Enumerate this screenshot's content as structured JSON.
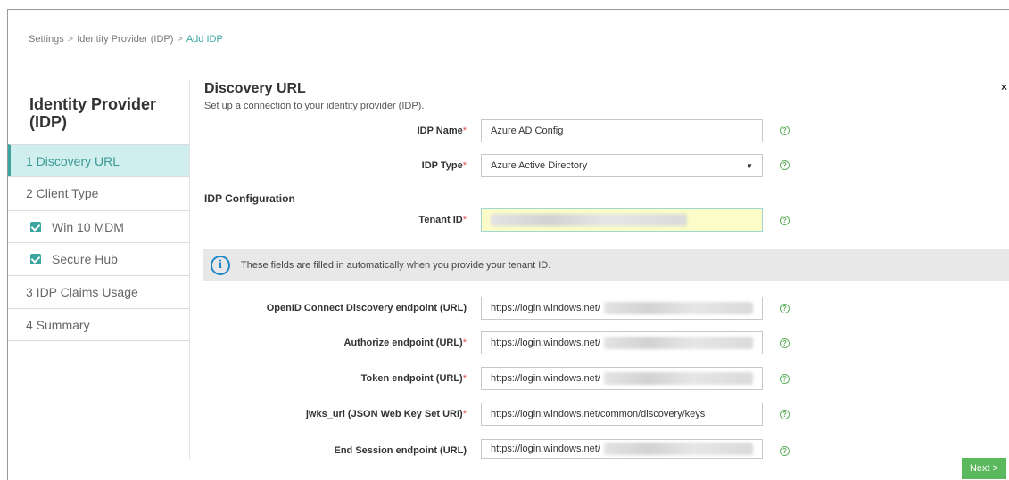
{
  "breadcrumb": {
    "item1": "Settings",
    "item2": "Identity Provider (IDP)",
    "item3": "Add IDP",
    "sep": ">"
  },
  "close": {
    "glyph": "×"
  },
  "sidebar": {
    "title": "Identity Provider (IDP)",
    "items": [
      {
        "label": "1  Discovery URL"
      },
      {
        "label": "2  Client Type"
      },
      {
        "label": "Win 10 MDM"
      },
      {
        "label": "Secure Hub"
      },
      {
        "label": "3  IDP Claims Usage"
      },
      {
        "label": "4  Summary"
      }
    ]
  },
  "main": {
    "title": "Discovery URL",
    "subtitle": "Set up a connection to your identity provider (IDP).",
    "idp_name": {
      "label": "IDP Name",
      "value": "Azure AD Config"
    },
    "idp_type": {
      "label": "IDP Type",
      "value": "Azure Active Directory"
    },
    "config_heading": "IDP Configuration",
    "tenant_id": {
      "label": "Tenant ID"
    },
    "info_text": "These fields are filled in automatically when you provide your tenant ID.",
    "openid": {
      "label": "OpenID Connect Discovery endpoint (URL)",
      "value": "https://login.windows.net/"
    },
    "authorize": {
      "label": "Authorize endpoint (URL)",
      "value": "https://login.windows.net/"
    },
    "token": {
      "label": "Token endpoint (URL)",
      "value": "https://login.windows.net/"
    },
    "jwks": {
      "label": "jwks_uri (JSON Web Key Set URI)",
      "value": "https://login.windows.net/common/discovery/keys"
    },
    "end_session": {
      "label": "End Session endpoint (URL)",
      "value": "https://login.windows.net/"
    },
    "required_mark": "*",
    "help_glyph": "?"
  },
  "footer": {
    "next_label": "Next >"
  },
  "colors": {
    "accent": "#3aa5a1",
    "next_button": "#5cb85c",
    "required": "#e05454",
    "info_icon": "#1e88c7"
  }
}
